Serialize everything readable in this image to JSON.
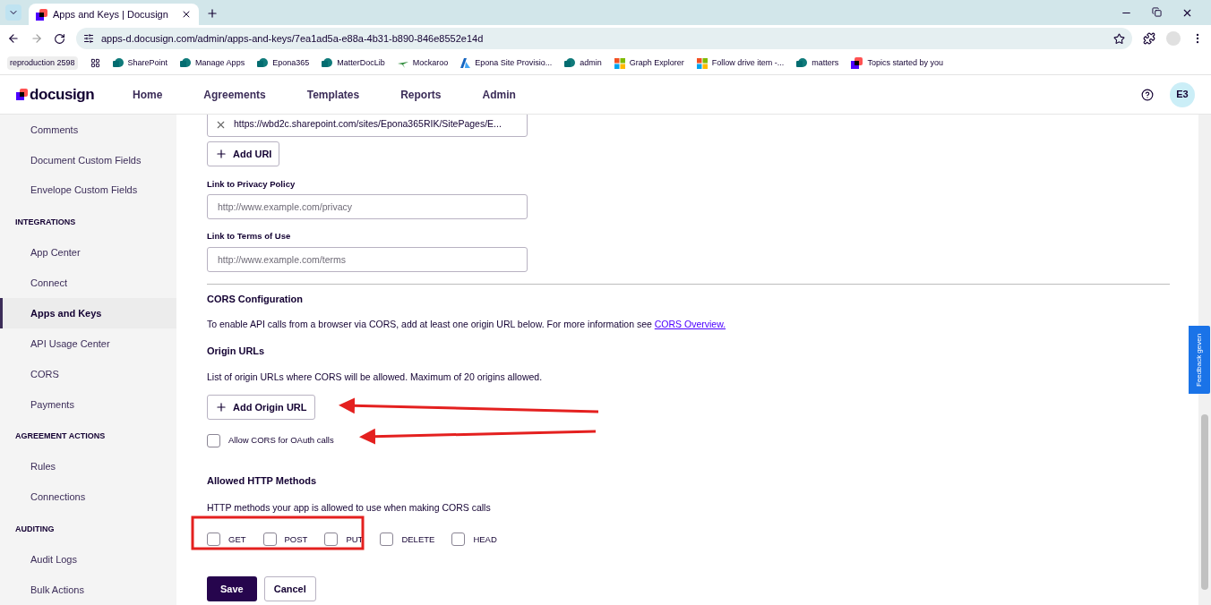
{
  "browser": {
    "tab": {
      "title": "Apps and Keys | Docusign"
    },
    "address": "apps-d.docusign.com/admin/apps-and-keys/7ea1ad5a-e88a-4b31-b890-846e8552e14d",
    "bookmarks": [
      {
        "label": "reproduction 2598",
        "kind": "chip"
      },
      {
        "label": "SharePoint",
        "kind": "sharepoint"
      },
      {
        "label": "Manage Apps",
        "kind": "sharepoint"
      },
      {
        "label": "Epona365",
        "kind": "sharepoint"
      },
      {
        "label": "MatterDocLib",
        "kind": "sharepoint"
      },
      {
        "label": "Mockaroo",
        "kind": "leaf"
      },
      {
        "label": "Epona Site Provisio...",
        "kind": "azure"
      },
      {
        "label": "admin",
        "kind": "sharepoint"
      },
      {
        "label": "Graph Explorer",
        "kind": "windows"
      },
      {
        "label": "Follow drive item -...",
        "kind": "windows"
      },
      {
        "label": "matters",
        "kind": "sharepoint"
      },
      {
        "label": "Topics started by you",
        "kind": "docusign"
      }
    ]
  },
  "header": {
    "logo": "docusign",
    "nav": [
      {
        "label": "Home"
      },
      {
        "label": "Agreements"
      },
      {
        "label": "Templates"
      },
      {
        "label": "Reports"
      },
      {
        "label": "Admin"
      }
    ],
    "avatar": "E3"
  },
  "sidebar": [
    {
      "kind": "item",
      "label": "Comments",
      "selected": false
    },
    {
      "kind": "item",
      "label": "Document Custom Fields",
      "selected": false
    },
    {
      "kind": "item",
      "label": "Envelope Custom Fields",
      "selected": false
    },
    {
      "kind": "section",
      "label": "INTEGRATIONS"
    },
    {
      "kind": "item",
      "label": "App Center",
      "selected": false
    },
    {
      "kind": "item",
      "label": "Connect",
      "selected": false
    },
    {
      "kind": "item",
      "label": "Apps and Keys",
      "selected": true
    },
    {
      "kind": "item",
      "label": "API Usage Center",
      "selected": false
    },
    {
      "kind": "item",
      "label": "CORS",
      "selected": false
    },
    {
      "kind": "item",
      "label": "Payments",
      "selected": false
    },
    {
      "kind": "section",
      "label": "AGREEMENT ACTIONS"
    },
    {
      "kind": "item",
      "label": "Rules",
      "selected": false
    },
    {
      "kind": "item",
      "label": "Connections",
      "selected": false
    },
    {
      "kind": "section",
      "label": "AUDITING"
    },
    {
      "kind": "item",
      "label": "Audit Logs",
      "selected": false
    },
    {
      "kind": "item",
      "label": "Bulk Actions",
      "selected": false
    }
  ],
  "redirect_uri": {
    "value": "https://wbd2c.sharepoint.com/sites/Epona365RIK/SitePages/E...",
    "add_button": "Add URI"
  },
  "privacy_policy": {
    "label": "Link to Privacy Policy",
    "placeholder": "http://www.example.com/privacy"
  },
  "terms_of_use": {
    "label": "Link to Terms of Use",
    "placeholder": "http://www.example.com/terms"
  },
  "cors": {
    "title": "CORS Configuration",
    "intro": "To enable API calls from a browser via CORS, add at least one origin URL below. For more information see",
    "link": "CORS Overview.",
    "origin_title": "Origin URLs",
    "origin_text": "List of origin URLs where CORS will be allowed. Maximum of 20 origins allowed.",
    "add_origin": "Add Origin URL",
    "oauth": {
      "label": "Allow CORS for OAuth calls",
      "checked": false
    }
  },
  "methods": {
    "title": "Allowed HTTP Methods",
    "text": "HTTP methods your app is allowed to use when making CORS calls",
    "items": [
      {
        "label": "GET",
        "checked": false
      },
      {
        "label": "POST",
        "checked": false
      },
      {
        "label": "PUT",
        "checked": false
      },
      {
        "label": "DELETE",
        "checked": false
      },
      {
        "label": "HEAD",
        "checked": false
      }
    ]
  },
  "actions": {
    "save": "Save",
    "cancel": "Cancel"
  },
  "feedback": "Feedback geven"
}
